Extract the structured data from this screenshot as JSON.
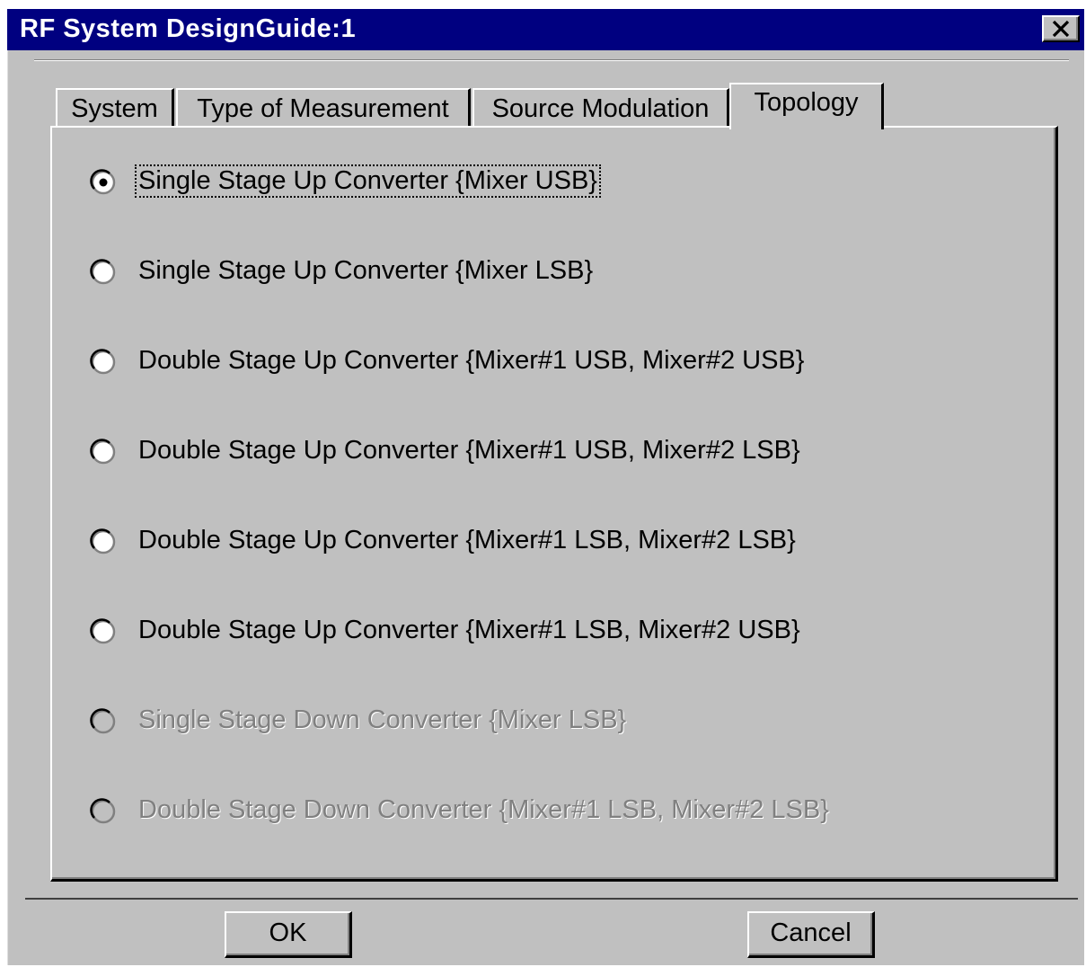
{
  "window": {
    "title": "RF System DesignGuide:1",
    "close_label": "×"
  },
  "tabs": [
    {
      "label": "System",
      "active": false
    },
    {
      "label": "Type of Measurement",
      "active": false
    },
    {
      "label": "Source Modulation",
      "active": false
    },
    {
      "label": "Topology",
      "active": true
    }
  ],
  "topology": {
    "options": [
      {
        "label": "Single Stage Up Converter {Mixer USB}",
        "selected": true,
        "enabled": true
      },
      {
        "label": "Single Stage Up Converter {Mixer LSB}",
        "selected": false,
        "enabled": true
      },
      {
        "label": "Double Stage Up Converter {Mixer#1 USB, Mixer#2 USB}",
        "selected": false,
        "enabled": true
      },
      {
        "label": "Double Stage Up Converter {Mixer#1 USB, Mixer#2 LSB}",
        "selected": false,
        "enabled": true
      },
      {
        "label": "Double Stage Up Converter {Mixer#1 LSB, Mixer#2 LSB}",
        "selected": false,
        "enabled": true
      },
      {
        "label": "Double Stage Up Converter {Mixer#1 LSB, Mixer#2 USB}",
        "selected": false,
        "enabled": true
      },
      {
        "label": "Single Stage Down Converter {Mixer LSB}",
        "selected": false,
        "enabled": false
      },
      {
        "label": "Double Stage Down Converter {Mixer#1 LSB, Mixer#2 LSB}",
        "selected": false,
        "enabled": false
      }
    ]
  },
  "buttons": {
    "ok_label": "OK",
    "cancel_label": "Cancel"
  },
  "colors": {
    "titlebar": "#000080",
    "face": "#c0c0c0",
    "disabled_text": "#808080"
  }
}
